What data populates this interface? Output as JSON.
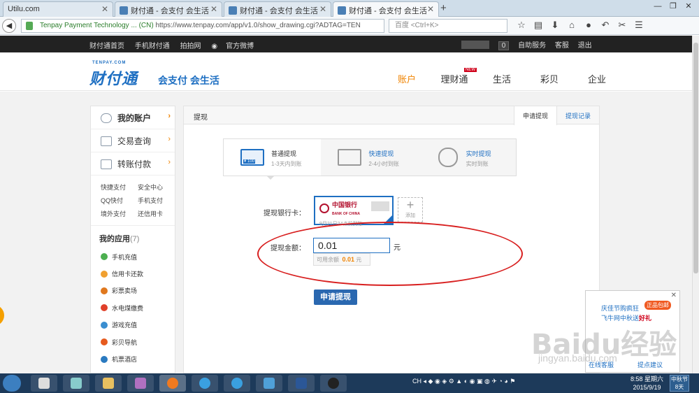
{
  "browser": {
    "tabs": [
      {
        "title": "Utilu.com"
      },
      {
        "title": "财付通 - 会支付 会生活"
      },
      {
        "title": "财付通 - 会支付 会生活"
      },
      {
        "title": "财付通 - 会支付 会生活"
      }
    ],
    "address": {
      "site_identity": "Tenpay Payment Technology ... (CN)",
      "url": "https://www.tenpay.com/app/v1.0/show_drawing.cgi?ADTAG=TEN"
    },
    "search_placeholder": "百度 <Ctrl+K>"
  },
  "topbar": {
    "links": [
      "财付通首页",
      "手机财付通",
      "拍拍网",
      "官方微博"
    ],
    "message_count": "0",
    "right_links": [
      "自助服务",
      "客服",
      "退出"
    ]
  },
  "header": {
    "logo_small": "TENPAY.COM",
    "logo_text": "财付通",
    "slogan": "会支付 会生活",
    "nav": [
      {
        "label": "账户",
        "active": true
      },
      {
        "label": "理财通",
        "badge": "NEW"
      },
      {
        "label": "生活"
      },
      {
        "label": "彩贝"
      },
      {
        "label": "企业"
      }
    ]
  },
  "sidebar": {
    "items": [
      "我的账户",
      "交易查询",
      "转账付款"
    ],
    "quick_links": [
      [
        "快捷支付",
        "安全中心"
      ],
      [
        "QQ快付",
        "手机支付"
      ],
      [
        "境外支付",
        "还信用卡"
      ]
    ],
    "apps_title": "我的应用",
    "apps_count": "(7)",
    "apps": [
      {
        "label": "手机充值",
        "color": "#4caf50"
      },
      {
        "label": "信用卡还款",
        "color": "#f0a030"
      },
      {
        "label": "彩票卖场",
        "color": "#e0781e"
      },
      {
        "label": "水电煤缴费",
        "color": "#e0402a"
      },
      {
        "label": "游戏充值",
        "color": "#3a8ed0"
      },
      {
        "label": "彩贝导航",
        "color": "#e65a1e"
      },
      {
        "label": "机票酒店",
        "color": "#2a7ac0"
      }
    ]
  },
  "content": {
    "title": "提现",
    "tabs": [
      "申请提现",
      "提现记录"
    ],
    "methods": [
      {
        "name": "普通提现",
        "sub": "1-3天内到账",
        "card_label": "¥ 100"
      },
      {
        "name": "快速提现",
        "sub": "2-4小时到账"
      },
      {
        "name": "实时提现",
        "sub": "实时到账"
      }
    ],
    "bank_label": "提现银行卡：",
    "bank_name": "中国银行",
    "bank_name_en": "BANK OF CHINA",
    "bank_note": "9月21日24点前到账",
    "add_label": "添加",
    "amount_label": "提现金额：",
    "amount_value": "0.01",
    "amount_unit": "元",
    "available_label": "可用余额",
    "available_value": "0.01",
    "available_unit": "元",
    "submit_label": "申请提现"
  },
  "popup": {
    "line1": "庆佳节购疯狂",
    "badge": "正品包邮",
    "line2_prefix": "飞牛网中秋送",
    "line2_highlight": "好礼",
    "online_help": "在线客服",
    "feedback": "提点建议"
  },
  "watermark": {
    "text": "Baidu经验",
    "sub": "jingyan.baidu.com"
  },
  "taskbar": {
    "lang": "CH",
    "time": "8:58 星期六",
    "date": "2015/9/19",
    "festival_title": "中秋节",
    "festival_days": "8天"
  }
}
